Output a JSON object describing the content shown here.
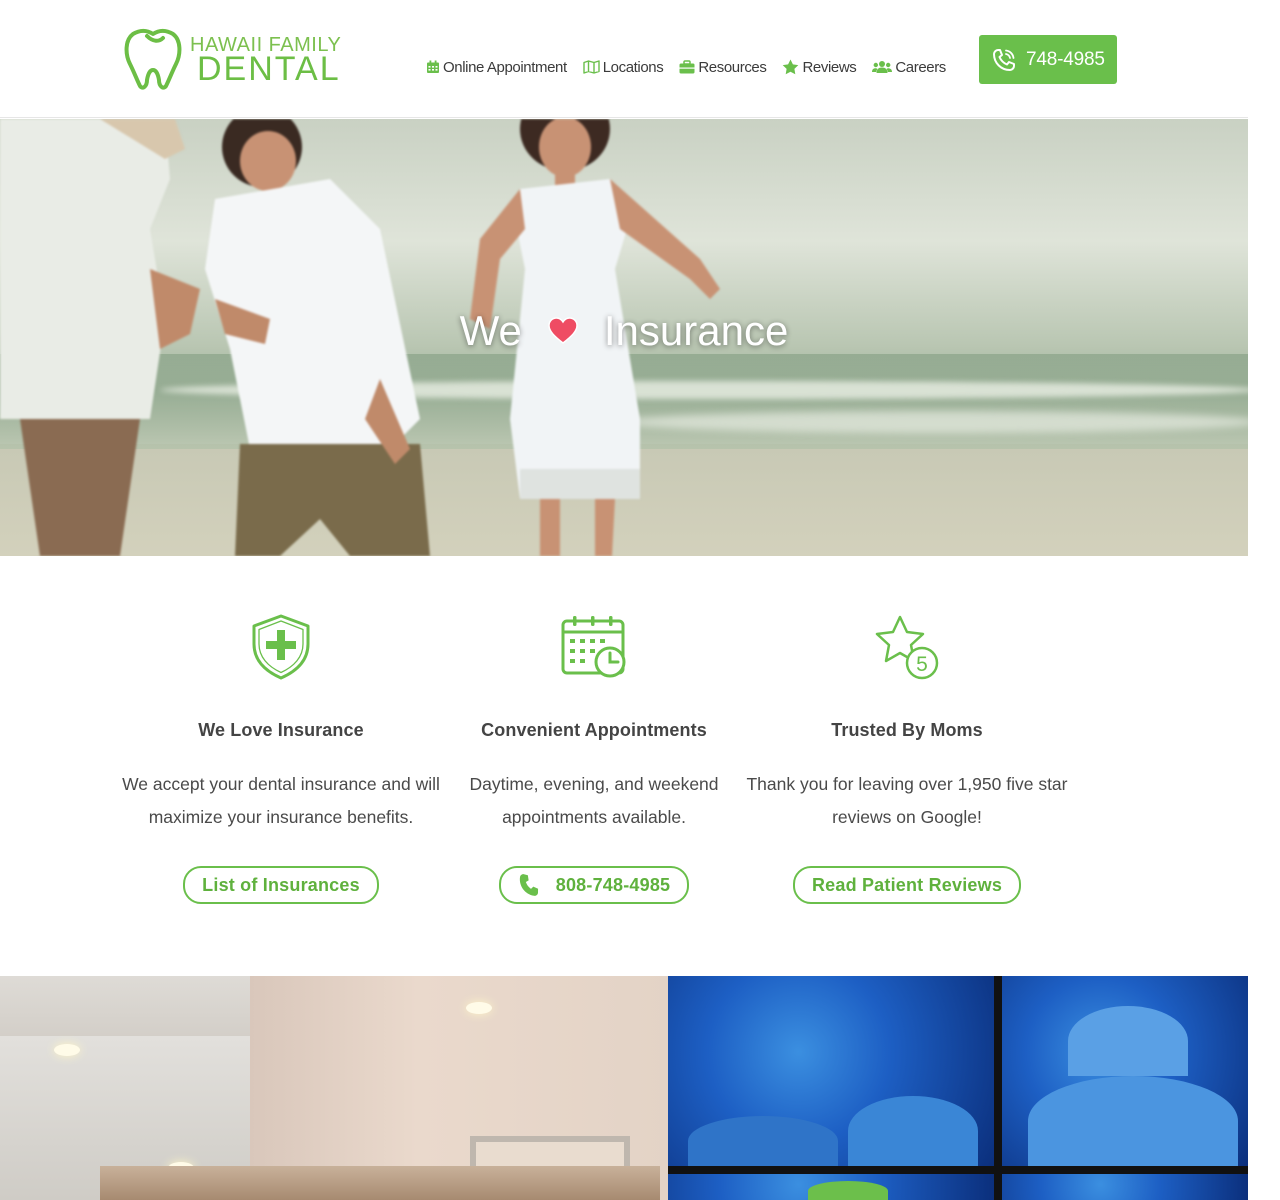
{
  "header": {
    "logo": {
      "line1": "HAWAII FAMILY",
      "line2": "DENTAL"
    },
    "nav": [
      {
        "label": "Online Appointment",
        "icon": "calendar-icon"
      },
      {
        "label": "Locations",
        "icon": "map-icon"
      },
      {
        "label": "Resources",
        "icon": "briefcase-icon"
      },
      {
        "label": "Reviews",
        "icon": "star-icon"
      },
      {
        "label": "Careers",
        "icon": "users-icon"
      }
    ],
    "phone": {
      "label": "748-4985",
      "icon": "phone-icon"
    }
  },
  "hero": {
    "word1": "We",
    "word2": "Insurance",
    "heart_icon": "heart-icon"
  },
  "features": [
    {
      "icon": "shield-plus-icon",
      "title": "We Love Insurance",
      "text": "We accept your dental insurance and will maximize your insurance benefits.",
      "button": "List of Insurances"
    },
    {
      "icon": "calendar-clock-icon",
      "title": "Convenient Appointments",
      "text": "Daytime, evening, and weekend appointments available.",
      "button": "808-748-4985",
      "button_icon": "phone-icon"
    },
    {
      "icon": "star-five-icon",
      "title": "Trusted By Moms",
      "text": "Thank you for leaving over 1,950 five star reviews on Google!",
      "button": "Read Patient Reviews"
    }
  ],
  "colors": {
    "brand_green": "#6abf4b",
    "text_dark": "#3b3b3b",
    "heart_red": "#ef4c63"
  }
}
